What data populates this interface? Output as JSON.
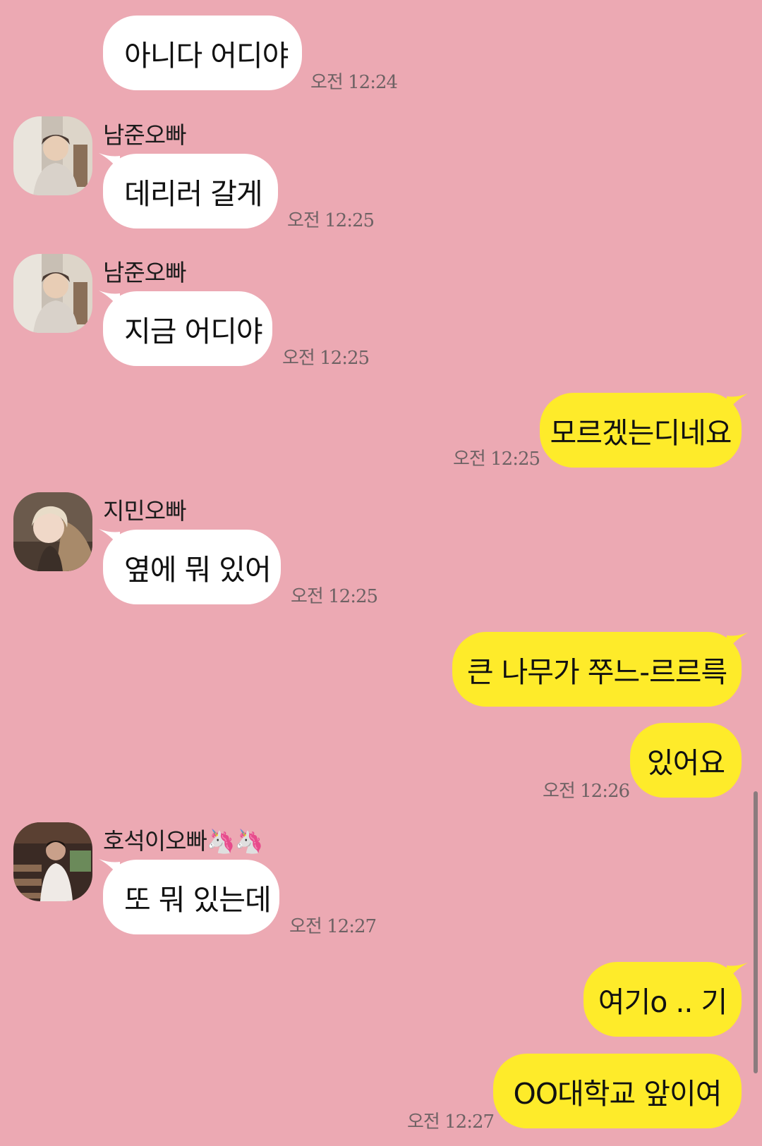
{
  "messages": [
    {
      "text": "아니다 어디야",
      "time": "오전 12:24"
    },
    {
      "sender": "남준오빠",
      "text": "데리러 갈게",
      "time": "오전 12:25"
    },
    {
      "sender": "남준오빠",
      "text": "지금 어디야",
      "time": "오전 12:25"
    },
    {
      "text": "모르겠는디네요",
      "time": "오전 12:25"
    },
    {
      "sender": "지민오빠",
      "text": "옆에 뭐 있어",
      "time": "오전 12:25"
    },
    {
      "text": "큰 나무가 쭈느-르르륵"
    },
    {
      "text": "있어요",
      "time": "오전 12:26"
    },
    {
      "sender": "호석이오빠🦄🦄",
      "text": "또 뭐 있는데",
      "time": "오전 12:27"
    },
    {
      "text": "여기o .. 기"
    },
    {
      "text": "OO대학교 앞이여",
      "time": "오전 12:27"
    }
  ],
  "colors": {
    "background": "#ECA9B3",
    "incoming": "#FFFFFF",
    "outgoing": "#FEEB2A"
  },
  "icons": [
    "avatar-namjoon",
    "avatar-jimin",
    "avatar-hoseok",
    "unicorn-emoji"
  ]
}
